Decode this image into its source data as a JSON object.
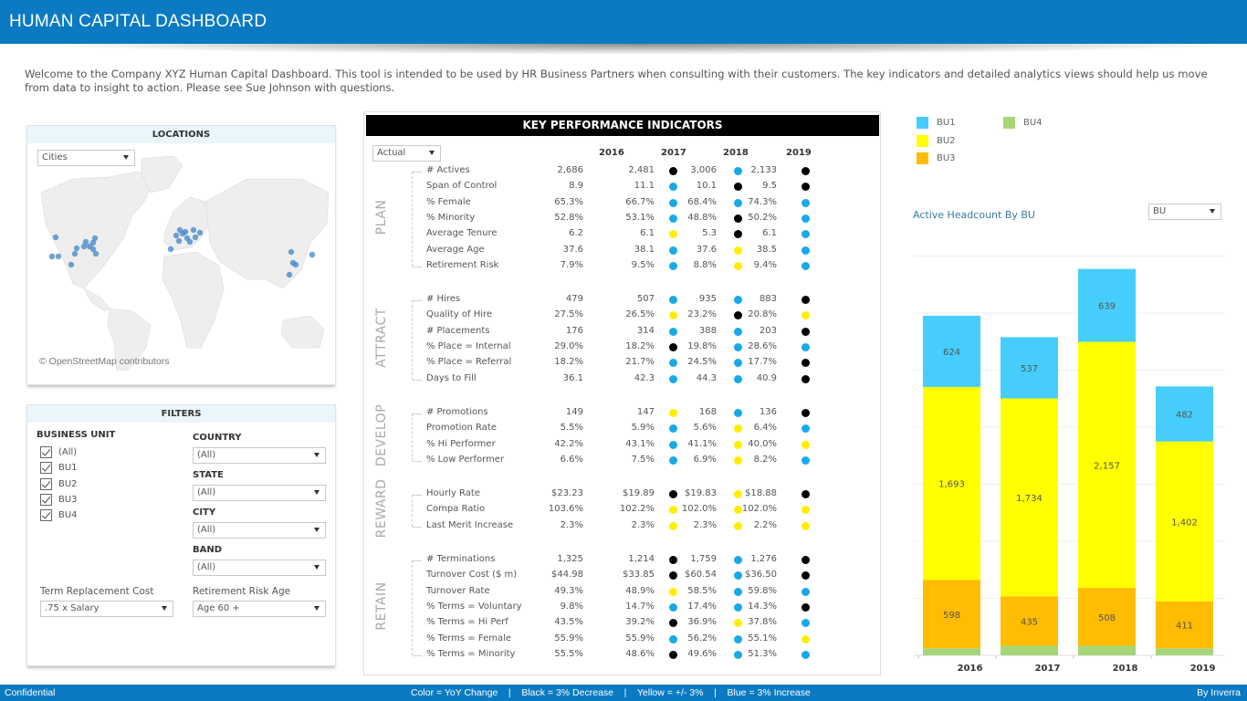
{
  "header": {
    "title": "HUMAN CAPITAL DASHBOARD"
  },
  "intro": "Welcome to the Company XYZ Human Capital Dashboard.  This tool is intended to be used by HR Business Partners when consulting with their customers.  The key indicators and detailed analytics views should help us move from data to insight to action.  Please see Sue Johnson with questions.",
  "locations": {
    "title": "LOCATIONS",
    "selector": "Cities",
    "attribution": "© OpenStreetMap contributors",
    "marker_color": "#3d86c6"
  },
  "filters": {
    "title": "FILTERS",
    "business_unit_label": "BUSINESS UNIT",
    "business_units": [
      {
        "label": "(All)",
        "checked": true
      },
      {
        "label": "BU1",
        "checked": true
      },
      {
        "label": "BU2",
        "checked": true
      },
      {
        "label": "BU3",
        "checked": true
      },
      {
        "label": "BU4",
        "checked": true
      }
    ],
    "country_label": "COUNTRY",
    "country_value": "(All)",
    "state_label": "STATE",
    "state_value": "(All)",
    "city_label": "CITY",
    "city_value": "(All)",
    "band_label": "BAND",
    "band_value": "(All)",
    "term_cost_label": "Term Replacement Cost",
    "term_cost_value": ".75 x Salary",
    "retirement_label": "Retirement Risk Age",
    "retirement_value": "Age 60 +"
  },
  "kpi": {
    "title": "KEY PERFORMANCE INDICATORS",
    "view_selector": "Actual",
    "years": [
      "2016",
      "2017",
      "2018",
      "2019"
    ],
    "colors": {
      "black": "#000000",
      "yellow": "#ffee00",
      "blue": "#17a9e8"
    },
    "sections": [
      {
        "name": "PLAN",
        "rows": [
          {
            "label": "# Actives",
            "values": [
              "2,686",
              "2,481",
              "3,006",
              "2,133"
            ],
            "dots": [
              "black",
              "blue",
              "black"
            ]
          },
          {
            "label": "Span of Control",
            "values": [
              "8.9",
              "11.1",
              "10.1",
              "9.5"
            ],
            "dots": [
              "blue",
              "black",
              "black"
            ]
          },
          {
            "label": "% Female",
            "values": [
              "65.3%",
              "66.7%",
              "68.4%",
              "74.3%"
            ],
            "dots": [
              "blue",
              "blue",
              "blue"
            ]
          },
          {
            "label": "% Minority",
            "values": [
              "52.8%",
              "53.1%",
              "48.8%",
              "50.2%"
            ],
            "dots": [
              "blue",
              "black",
              "blue"
            ]
          },
          {
            "label": "Average Tenure",
            "values": [
              "6.2",
              "6.1",
              "5.3",
              "6.1"
            ],
            "dots": [
              "yellow",
              "black",
              "blue"
            ]
          },
          {
            "label": "Average Age",
            "values": [
              "37.6",
              "38.1",
              "37.6",
              "38.5"
            ],
            "dots": [
              "blue",
              "yellow",
              "blue"
            ]
          },
          {
            "label": "Retirement Risk",
            "values": [
              "7.9%",
              "9.5%",
              "8.8%",
              "9.4%"
            ],
            "dots": [
              "blue",
              "yellow",
              "blue"
            ]
          }
        ]
      },
      {
        "name": "ATTRACT",
        "rows": [
          {
            "label": "# Hires",
            "values": [
              "479",
              "507",
              "935",
              "883"
            ],
            "dots": [
              "blue",
              "blue",
              "black"
            ]
          },
          {
            "label": "Quality of Hire",
            "values": [
              "27.5%",
              "26.5%",
              "23.2%",
              "20.8%"
            ],
            "dots": [
              "yellow",
              "black",
              "yellow"
            ]
          },
          {
            "label": "# Placements",
            "values": [
              "176",
              "314",
              "388",
              "203"
            ],
            "dots": [
              "blue",
              "blue",
              "black"
            ]
          },
          {
            "label": "% Place = Internal",
            "values": [
              "29.0%",
              "18.2%",
              "19.8%",
              "28.6%"
            ],
            "dots": [
              "black",
              "blue",
              "blue"
            ]
          },
          {
            "label": "% Place = Referral",
            "values": [
              "18.2%",
              "21.7%",
              "24.5%",
              "17.7%"
            ],
            "dots": [
              "blue",
              "blue",
              "black"
            ]
          },
          {
            "label": "Days to Fill",
            "values": [
              "36.1",
              "42.3",
              "44.3",
              "40.9"
            ],
            "dots": [
              "blue",
              "blue",
              "black"
            ]
          }
        ]
      },
      {
        "name": "DEVELOP",
        "rows": [
          {
            "label": "# Promotions",
            "values": [
              "149",
              "147",
              "168",
              "136"
            ],
            "dots": [
              "yellow",
              "blue",
              "black"
            ]
          },
          {
            "label": "Promotion Rate",
            "values": [
              "5.5%",
              "5.9%",
              "5.6%",
              "6.4%"
            ],
            "dots": [
              "blue",
              "yellow",
              "blue"
            ]
          },
          {
            "label": "% Hi Performer",
            "values": [
              "42.2%",
              "43.1%",
              "41.1%",
              "40.0%"
            ],
            "dots": [
              "blue",
              "yellow",
              "yellow"
            ]
          },
          {
            "label": "% Low Performer",
            "values": [
              "6.6%",
              "7.5%",
              "6.9%",
              "8.2%"
            ],
            "dots": [
              "blue",
              "yellow",
              "blue"
            ]
          }
        ]
      },
      {
        "name": "REWARD",
        "rows": [
          {
            "label": "Hourly Rate",
            "values": [
              "$23.23",
              "$19.89",
              "$19.83",
              "$18.88"
            ],
            "dots": [
              "black",
              "yellow",
              "black"
            ]
          },
          {
            "label": "Compa Ratio",
            "values": [
              "103.6%",
              "102.2%",
              "102.0%",
              "102.0%"
            ],
            "dots": [
              "yellow",
              "yellow",
              "yellow"
            ]
          },
          {
            "label": "Last Merit Increase",
            "values": [
              "2.3%",
              "2.3%",
              "2.3%",
              "2.2%"
            ],
            "dots": [
              "yellow",
              "yellow",
              "yellow"
            ]
          }
        ]
      },
      {
        "name": "RETAIN",
        "rows": [
          {
            "label": "# Terminations",
            "values": [
              "1,325",
              "1,214",
              "1,759",
              "1,276"
            ],
            "dots": [
              "black",
              "blue",
              "black"
            ]
          },
          {
            "label": "Turnover Cost ($ m)",
            "values": [
              "$44.98",
              "$33.85",
              "$60.54",
              "$36.50"
            ],
            "dots": [
              "black",
              "blue",
              "black"
            ]
          },
          {
            "label": "Turnover Rate",
            "values": [
              "49.3%",
              "48.9%",
              "58.5%",
              "59.8%"
            ],
            "dots": [
              "yellow",
              "blue",
              "blue"
            ]
          },
          {
            "label": "% Terms = Voluntary",
            "values": [
              "9.8%",
              "14.7%",
              "17.4%",
              "14.3%"
            ],
            "dots": [
              "blue",
              "blue",
              "black"
            ]
          },
          {
            "label": "% Terms = Hi Perf",
            "values": [
              "43.5%",
              "39.2%",
              "36.9%",
              "37.8%"
            ],
            "dots": [
              "black",
              "yellow",
              "blue"
            ]
          },
          {
            "label": "% Terms = Female",
            "values": [
              "55.9%",
              "55.9%",
              "56.2%",
              "55.1%"
            ],
            "dots": [
              "blue",
              "blue",
              "yellow"
            ]
          },
          {
            "label": "% Terms = Minority",
            "values": [
              "55.5%",
              "48.6%",
              "49.6%",
              "51.3%"
            ],
            "dots": [
              "black",
              "blue",
              "blue"
            ]
          }
        ]
      }
    ]
  },
  "headcount": {
    "title": "Active Headcount By BU",
    "selector": "BU"
  },
  "chart_data": {
    "type": "bar",
    "stacked": true,
    "title": "Active Headcount By BU",
    "categories": [
      "2016",
      "2017",
      "2018",
      "2019"
    ],
    "series": [
      {
        "name": "BU4",
        "color": "#a6d67a",
        "values": [
          62,
          83,
          83,
          62
        ],
        "labeled": false
      },
      {
        "name": "BU3",
        "color": "#ffbc00",
        "values": [
          598,
          435,
          508,
          411
        ],
        "labeled": true
      },
      {
        "name": "BU2",
        "color": "#ffff00",
        "values": [
          1693,
          1734,
          2157,
          1402
        ],
        "labeled": true
      },
      {
        "name": "BU1",
        "color": "#46cdfc",
        "values": [
          624,
          537,
          639,
          482
        ],
        "labeled": true
      }
    ],
    "legend": [
      "BU1",
      "BU2",
      "BU3",
      "BU4"
    ],
    "legend_position": "top-left",
    "ylim": [
      0,
      3600
    ],
    "grid": true,
    "xlabel": "",
    "ylabel": ""
  },
  "footer": {
    "left": "Confidential",
    "center": "Color = YoY Change    |    Black = 3% Decrease    |    Yellow = +/- 3%    |    Blue = 3% Increase",
    "right": "By Inverra"
  }
}
